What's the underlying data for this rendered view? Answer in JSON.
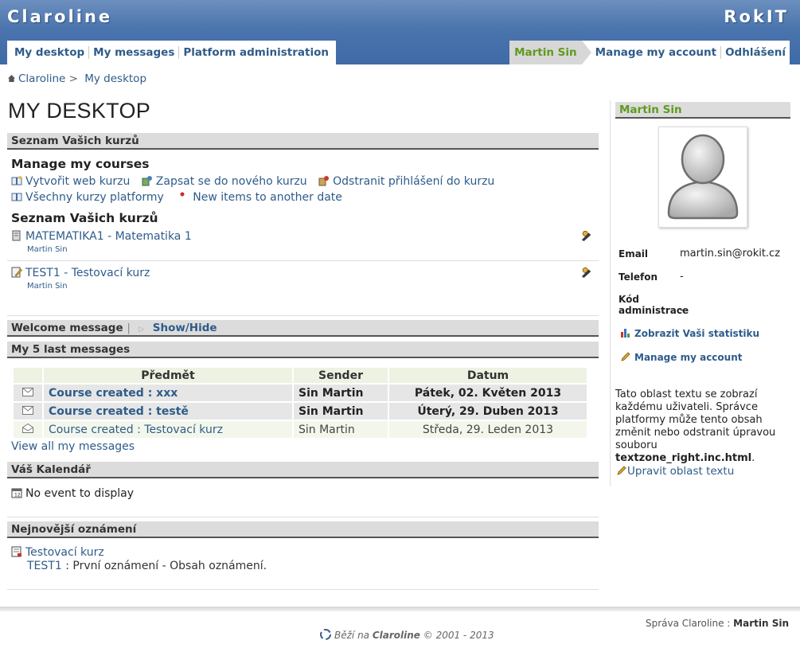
{
  "header": {
    "brand": "Claroline",
    "org": "RokIT",
    "main_nav": [
      "My desktop",
      "My messages",
      "Platform administration"
    ],
    "user_name": "Martin Sin",
    "user_nav": [
      "Manage my account",
      "Odhlášení"
    ]
  },
  "breadcrumb": {
    "root": "Claroline",
    "sep": ">",
    "current": "My desktop"
  },
  "page_title": "MY DESKTOP",
  "courses_section": {
    "title": "Seznam Vašich kurzů",
    "manage_heading": "Manage my courses",
    "links": [
      "Vytvořit web kurzu",
      "Zapsat se do nového kurzu",
      "Odstranit přihlášení do kurzu",
      "Všechny kurzy platformy",
      "New items to another date"
    ],
    "list_heading": "Seznam Vašich kurzů",
    "courses": [
      {
        "title": "MATEMATIKA1 - Matematika 1",
        "owner": "Martin Sin"
      },
      {
        "title": "TEST1 - Testovací kurz",
        "owner": "Martin Sin"
      }
    ]
  },
  "welcome": {
    "title": "Welcome message",
    "toggle": "Show/Hide"
  },
  "messages": {
    "title": "My 5 last messages",
    "columns": [
      "Předmět",
      "Sender",
      "Datum"
    ],
    "rows": [
      {
        "subject": "Course created : xxx",
        "sender": "Sin Martin",
        "date": "Pátek, 02. Květen 2013",
        "read": false
      },
      {
        "subject": "Course created : testě",
        "sender": "Sin Martin",
        "date": "Úterý, 29. Duben 2013",
        "read": false
      },
      {
        "subject": "Course created : Testovací kurz",
        "sender": "Sin Martin",
        "date": "Středa, 29. Leden 2013",
        "read": true
      }
    ],
    "view_all": "View all my messages"
  },
  "calendar": {
    "title": "Váš Kalendář",
    "empty": "No event to display"
  },
  "announcements": {
    "title": "Nejnovější oznámení",
    "course_link": "Testovací kurz",
    "course_code": "TEST1",
    "text": " : První oznámení - Obsah oznámení."
  },
  "sidebar": {
    "user_title": "Martin Sin",
    "email_label": "Email",
    "email": "martin.sin@rokit.cz",
    "phone_label": "Telefon",
    "phone": "-",
    "code_label_1": "Kód",
    "code_label_2": "administrace",
    "code": "-",
    "stats_link": "Zobrazit Vaši statistiku",
    "manage_link": "Manage my account",
    "textzone_text": "Tato oblast textu se zobrazí každému uživateli. Správce platformy může tento obsah změnit nebo odstranit úpravou souboru",
    "textzone_file": "textzone_right.inc.html",
    "textzone_end": ".",
    "edit_link": "Upravit oblast textu"
  },
  "footer": {
    "admin_label": "Správa Claroline : ",
    "admin_name": "Martin Sin",
    "powered_prefix": "Běží na ",
    "powered_brand": "Claroline",
    "powered_suffix": " © 2001 - 2013"
  },
  "colors": {
    "header": "#4a74ad",
    "link": "#2e5c8a",
    "user_green": "#5f9a1e",
    "bar": "#dcdcdc"
  }
}
